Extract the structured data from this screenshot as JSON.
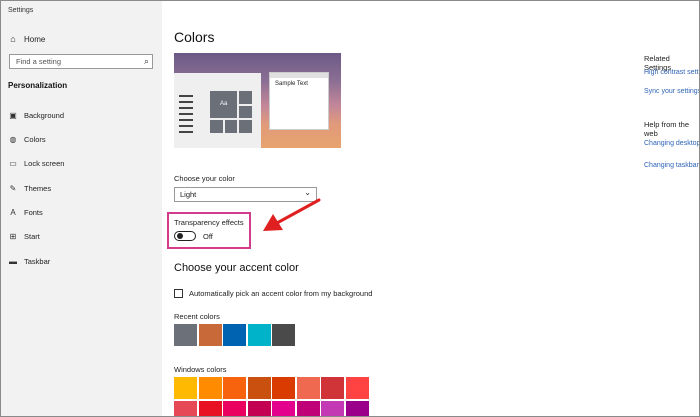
{
  "window": {
    "title": "Settings"
  },
  "sidebar": {
    "home_label": "Home",
    "search_placeholder": "Find a setting",
    "section_label": "Personalization",
    "items": [
      {
        "label": "Background",
        "icon": "image-icon"
      },
      {
        "label": "Colors",
        "icon": "palette-icon"
      },
      {
        "label": "Lock screen",
        "icon": "monitor-lock-icon"
      },
      {
        "label": "Themes",
        "icon": "brush-icon"
      },
      {
        "label": "Fonts",
        "icon": "font-icon"
      },
      {
        "label": "Start",
        "icon": "start-grid-icon"
      },
      {
        "label": "Taskbar",
        "icon": "taskbar-icon"
      }
    ]
  },
  "main": {
    "title": "Colors",
    "preview": {
      "sample_text": "Sample Text",
      "tile_label": "Aa"
    },
    "choose_color": {
      "label": "Choose your color",
      "value": "Light"
    },
    "transparency": {
      "label": "Transparency effects",
      "state": "Off"
    },
    "accent": {
      "title": "Choose your accent color",
      "auto_pick_label": "Automatically pick an accent color from my background",
      "recent_label": "Recent colors",
      "recent_colors": [
        "#6b7079",
        "#c8693a",
        "#0063b1",
        "#00b3c8",
        "#4a4a4a"
      ],
      "windows_label": "Windows colors",
      "windows_colors_row1": [
        "#ffb900",
        "#ff8c00",
        "#f7630c",
        "#ca5010",
        "#da3b01",
        "#ef6950",
        "#d13438",
        "#ff4343"
      ],
      "windows_colors_row2": [
        "#e74856",
        "#e81123",
        "#ea005e",
        "#c30052",
        "#e3008c",
        "#bf0077",
        "#c239b3",
        "#9a0089"
      ]
    }
  },
  "related": {
    "title": "Related Settings",
    "links": [
      "High contrast settings",
      "Sync your settings"
    ],
    "help_title": "Help from the web",
    "help_links": [
      "Changing desktop colors",
      "Changing taskbar color"
    ]
  },
  "colors": {
    "highlight": "#d23c8b",
    "arrow": "#e02020",
    "link": "#2e63b6"
  }
}
